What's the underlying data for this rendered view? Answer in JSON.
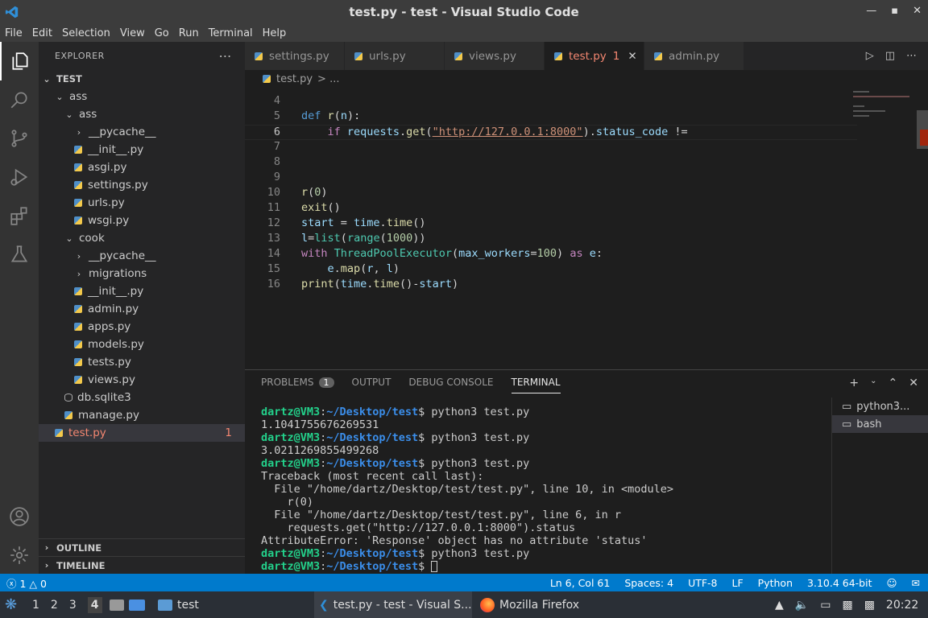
{
  "titlebar": {
    "title": "test.py - test - Visual Studio Code",
    "controls": [
      "—",
      "▪",
      "✕"
    ]
  },
  "menu": [
    "File",
    "Edit",
    "Selection",
    "View",
    "Go",
    "Run",
    "Terminal",
    "Help"
  ],
  "sidebar": {
    "header": "EXPLORER",
    "more": "⋯",
    "root": "TEST",
    "tree": [
      {
        "label": "ass",
        "depth": 1,
        "type": "folder-open"
      },
      {
        "label": "ass",
        "depth": 2,
        "type": "folder-open"
      },
      {
        "label": "__pycache__",
        "depth": 3,
        "type": "folder"
      },
      {
        "label": "__init__.py",
        "depth": 3,
        "type": "py"
      },
      {
        "label": "asgi.py",
        "depth": 3,
        "type": "py"
      },
      {
        "label": "settings.py",
        "depth": 3,
        "type": "py"
      },
      {
        "label": "urls.py",
        "depth": 3,
        "type": "py"
      },
      {
        "label": "wsgi.py",
        "depth": 3,
        "type": "py"
      },
      {
        "label": "cook",
        "depth": 2,
        "type": "folder-open"
      },
      {
        "label": "__pycache__",
        "depth": 3,
        "type": "folder"
      },
      {
        "label": "migrations",
        "depth": 3,
        "type": "folder"
      },
      {
        "label": "__init__.py",
        "depth": 3,
        "type": "py"
      },
      {
        "label": "admin.py",
        "depth": 3,
        "type": "py"
      },
      {
        "label": "apps.py",
        "depth": 3,
        "type": "py"
      },
      {
        "label": "models.py",
        "depth": 3,
        "type": "py"
      },
      {
        "label": "tests.py",
        "depth": 3,
        "type": "py"
      },
      {
        "label": "views.py",
        "depth": 3,
        "type": "py"
      },
      {
        "label": "db.sqlite3",
        "depth": 2,
        "type": "db"
      },
      {
        "label": "manage.py",
        "depth": 2,
        "type": "py"
      },
      {
        "label": "test.py",
        "depth": 1,
        "type": "py",
        "badge": "1",
        "selected": true
      }
    ],
    "outline": "OUTLINE",
    "timeline": "TIMELINE"
  },
  "tabs": [
    {
      "label": "settings.py"
    },
    {
      "label": "urls.py"
    },
    {
      "label": "views.py"
    },
    {
      "label": "test.py",
      "active": true,
      "badge": "1"
    },
    {
      "label": "admin.py"
    }
  ],
  "breadcrumb": {
    "file": "test.py",
    "rest": "> ..."
  },
  "editor": {
    "line_numbers": [
      "4",
      "5",
      "6",
      "7",
      "8",
      "9",
      "10",
      "11",
      "12",
      "13",
      "14",
      "15",
      "16"
    ]
  },
  "panel": {
    "tabs": [
      "PROBLEMS",
      "OUTPUT",
      "DEBUG CONSOLE",
      "TERMINAL"
    ],
    "problems_count": "1",
    "prompt_user": "dartz@VM3",
    "prompt_path": "~/Desktop/test",
    "lines": [
      {
        "p": true,
        "cmd": "python3 test.py"
      },
      {
        "t": "1.1041755676269531"
      },
      {
        "p": true,
        "cmd": "python3 test.py"
      },
      {
        "t": "3.0211269855499268"
      },
      {
        "p": true,
        "cmd": "python3 test.py"
      },
      {
        "t": "Traceback (most recent call last):"
      },
      {
        "t": "  File \"/home/dartz/Desktop/test/test.py\", line 10, in <module>"
      },
      {
        "t": "    r(0)"
      },
      {
        "t": "  File \"/home/dartz/Desktop/test/test.py\", line 6, in r"
      },
      {
        "t": "    requests.get(\"http://127.0.0.1:8000\").status"
      },
      {
        "t": "AttributeError: 'Response' object has no attribute 'status'"
      },
      {
        "p": true,
        "cmd": "python3 test.py"
      },
      {
        "p": true,
        "cmd": ""
      }
    ],
    "terminals": [
      "python3...",
      "bash"
    ]
  },
  "status": {
    "errors": "1",
    "warnings": "0",
    "position": "Ln 6, Col 61",
    "spaces": "Spaces: 4",
    "encoding": "UTF-8",
    "eol": "LF",
    "language": "Python",
    "interpreter": "3.10.4 64-bit"
  },
  "taskbar": {
    "workspaces": [
      "1",
      "2",
      "3",
      "4"
    ],
    "folder": "test",
    "tasks": [
      "test.py - test - Visual S...",
      "Mozilla Firefox"
    ],
    "clock": "20:22"
  },
  "colors": {
    "accent": "#007acc",
    "activity": "#333333",
    "sidebar": "#252526",
    "editor": "#1e1e1e"
  }
}
